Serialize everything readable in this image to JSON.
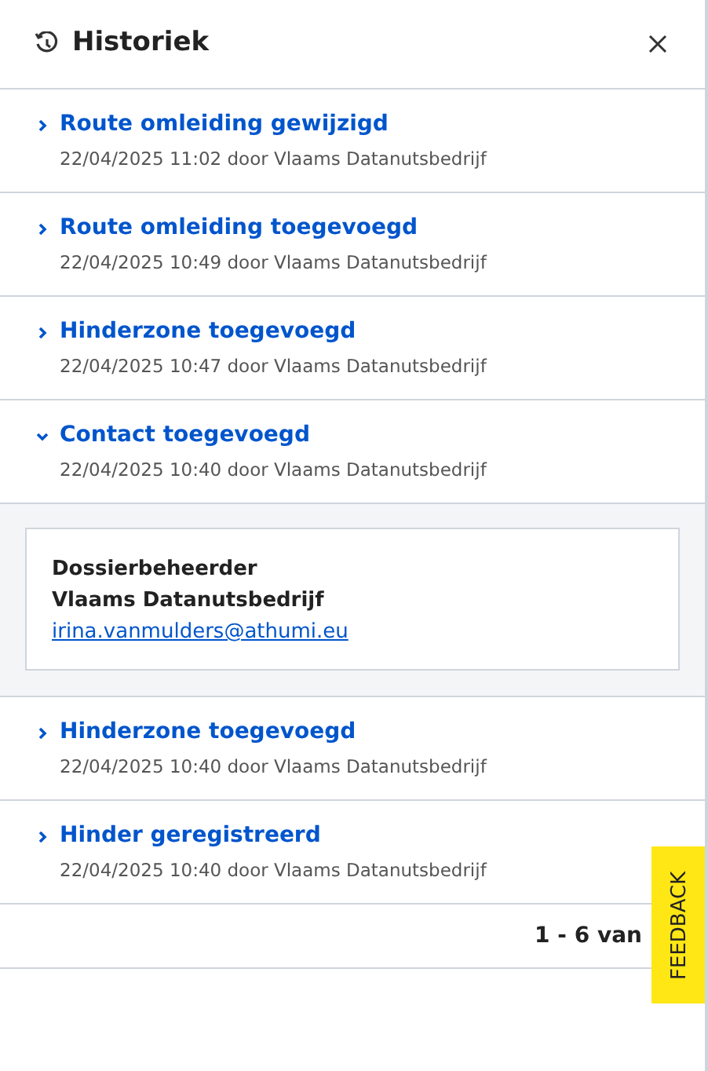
{
  "panel": {
    "title": "Historiek"
  },
  "entries": [
    {
      "title": "Route omleiding gewijzigd",
      "meta": "22/04/2025 11:02 door Vlaams Datanutsbedrijf",
      "expanded": false
    },
    {
      "title": "Route omleiding toegevoegd",
      "meta": "22/04/2025 10:49 door Vlaams Datanutsbedrijf",
      "expanded": false
    },
    {
      "title": "Hinderzone toegevoegd",
      "meta": "22/04/2025 10:47 door Vlaams Datanutsbedrijf",
      "expanded": false
    },
    {
      "title": "Contact toegevoegd",
      "meta": "22/04/2025 10:40 door Vlaams Datanutsbedrijf",
      "expanded": true,
      "details": {
        "role": "Dossierbeheerder",
        "organisation": "Vlaams Datanutsbedrijf",
        "email": "irina.vanmulders@athumi.eu"
      }
    },
    {
      "title": "Hinderzone toegevoegd",
      "meta": "22/04/2025 10:40 door Vlaams Datanutsbedrijf",
      "expanded": false
    },
    {
      "title": "Hinder geregistreerd",
      "meta": "22/04/2025 10:40 door Vlaams Datanutsbedrijf",
      "expanded": false
    }
  ],
  "pagination": "1 - 6 van",
  "feedback_tab": "FEEDBACK"
}
